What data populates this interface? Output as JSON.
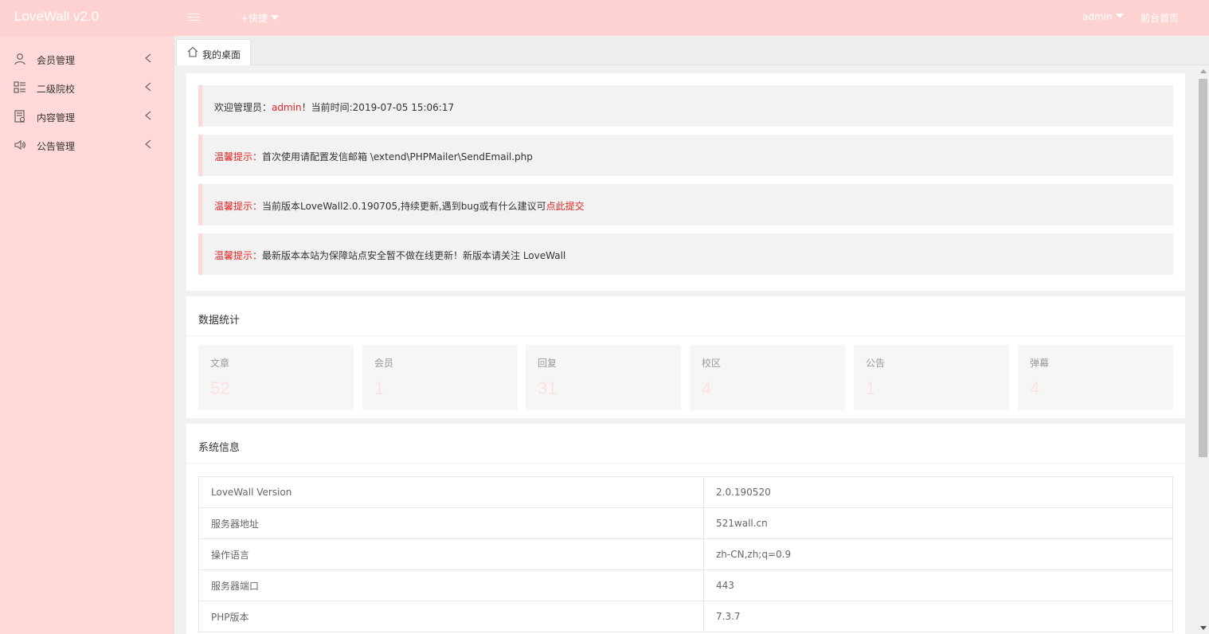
{
  "header": {
    "logo": "LoveWall v2.0",
    "quick_label": "+快捷",
    "admin_label": "admin",
    "front_link": "前台首页"
  },
  "sidebar": {
    "items": [
      {
        "label": "会员管理",
        "icon": "user-icon"
      },
      {
        "label": "二级院校",
        "icon": "list-icon"
      },
      {
        "label": "内容管理",
        "icon": "content-icon"
      },
      {
        "label": "公告管理",
        "icon": "speaker-icon"
      }
    ]
  },
  "tabs": [
    {
      "label": "我的桌面",
      "icon": "home-icon"
    }
  ],
  "notices": {
    "welcome": {
      "prefix": "欢迎管理员：",
      "user": "admin",
      "suffix": "！当前时间:2019-07-05 15:06:17"
    },
    "tips": [
      {
        "tag": "温馨提示：",
        "text": "首次使用请配置发信邮箱 \\extend\\PHPMailer\\SendEmail.php",
        "link": ""
      },
      {
        "tag": "温馨提示：",
        "text": "当前版本LoveWall2.0.190705,持续更新,遇到bug或有什么建议可",
        "link": "点此提交"
      },
      {
        "tag": "温馨提示：",
        "text": "最新版本本站为保障站点安全暂不做在线更新！新版本请关注 LoveWall",
        "link": ""
      }
    ]
  },
  "stats": {
    "title": "数据统计",
    "items": [
      {
        "label": "文章",
        "value": "52"
      },
      {
        "label": "会员",
        "value": "1"
      },
      {
        "label": "回复",
        "value": "31"
      },
      {
        "label": "校区",
        "value": "4"
      },
      {
        "label": "公告",
        "value": "1"
      },
      {
        "label": "弹幕",
        "value": "4"
      }
    ]
  },
  "system": {
    "title": "系统信息",
    "rows": [
      {
        "key": "LoveWall Version",
        "value": "2.0.190520"
      },
      {
        "key": "服务器地址",
        "value": "521wall.cn"
      },
      {
        "key": "操作语言",
        "value": "zh-CN,zh;q=0.9"
      },
      {
        "key": "服务器端口",
        "value": "443"
      },
      {
        "key": "PHP版本",
        "value": "7.3.7"
      }
    ]
  },
  "colors": {
    "header_bg": "#ffd2d2",
    "sidebar_bg": "#ffd9d9",
    "accent_red": "#ff0000",
    "stat_value": "#ffe0e0"
  }
}
